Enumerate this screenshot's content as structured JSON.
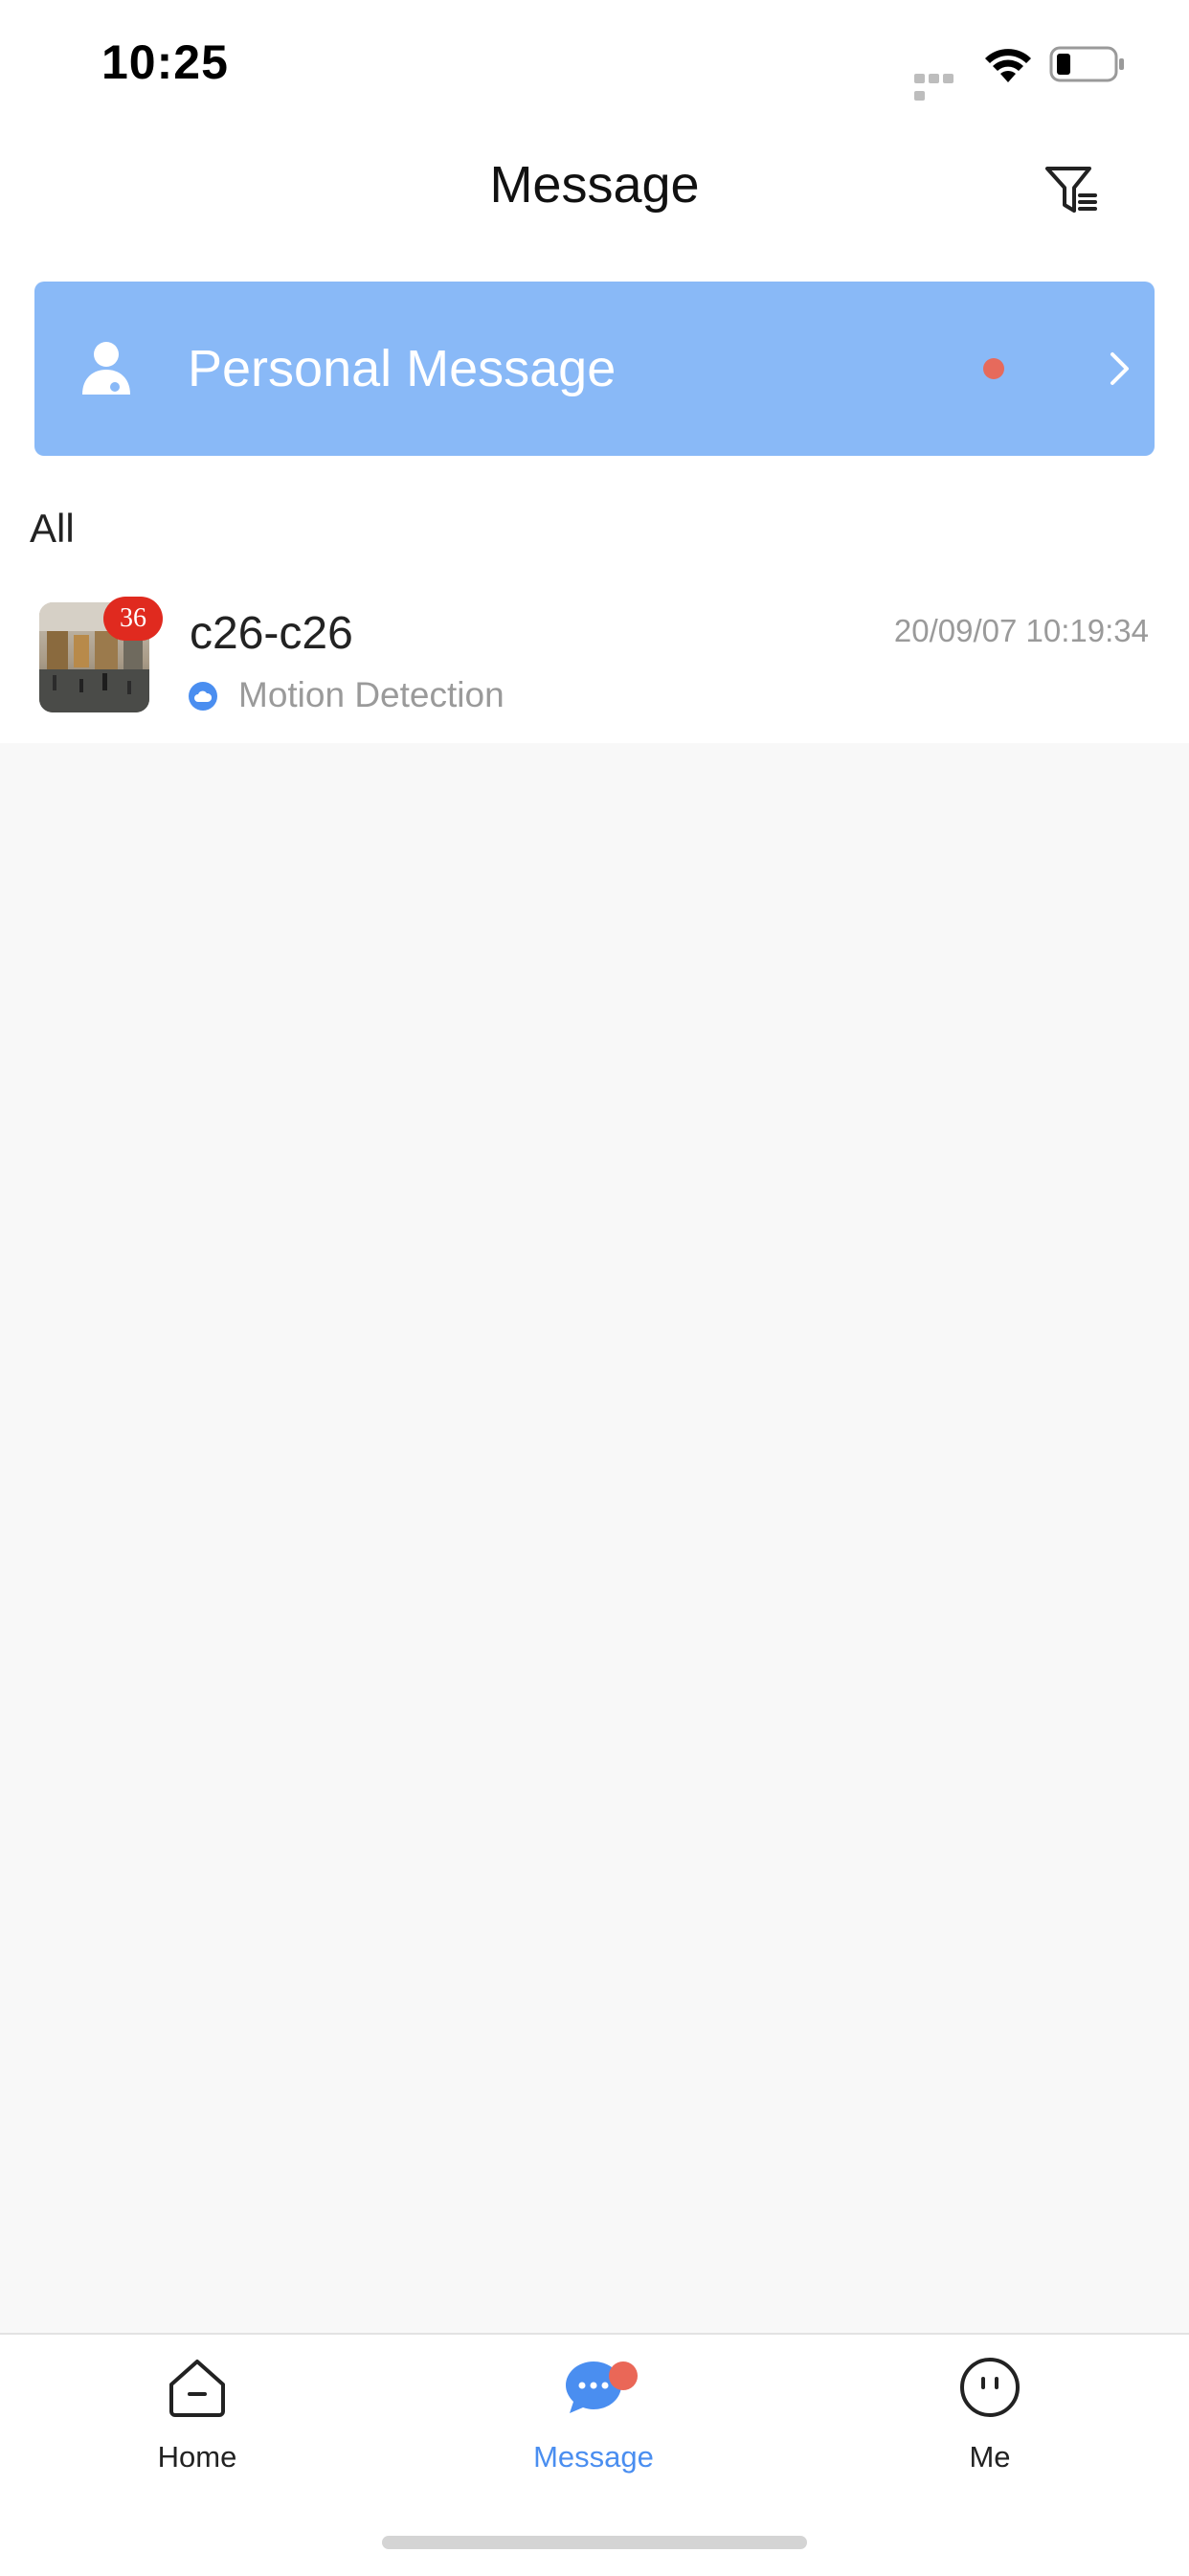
{
  "status_bar": {
    "time": "10:25"
  },
  "header": {
    "title": "Message",
    "filter_icon": "filter-icon"
  },
  "personal_message": {
    "label": "Personal Message",
    "icon": "user-icon",
    "unread_dot_color": "#e66a5c",
    "chevron_icon": "chevron-right-icon"
  },
  "section": {
    "label": "All"
  },
  "messages": [
    {
      "title": "c26-c26",
      "timestamp": "20/09/07 10:19:34",
      "badge_count": "36",
      "subtitle": "Motion Detection",
      "type_icon": "cloud-icon"
    }
  ],
  "tabs": [
    {
      "label": "Home",
      "icon": "home-icon",
      "active": false
    },
    {
      "label": "Message",
      "icon": "message-bubble-icon",
      "active": true
    },
    {
      "label": "Me",
      "icon": "face-icon",
      "active": false
    }
  ],
  "colors": {
    "accent": "#4a8ef0",
    "personal_card_bg": "#89b9f7",
    "badge": "#e02a1f",
    "background": "#f8f8f8"
  }
}
